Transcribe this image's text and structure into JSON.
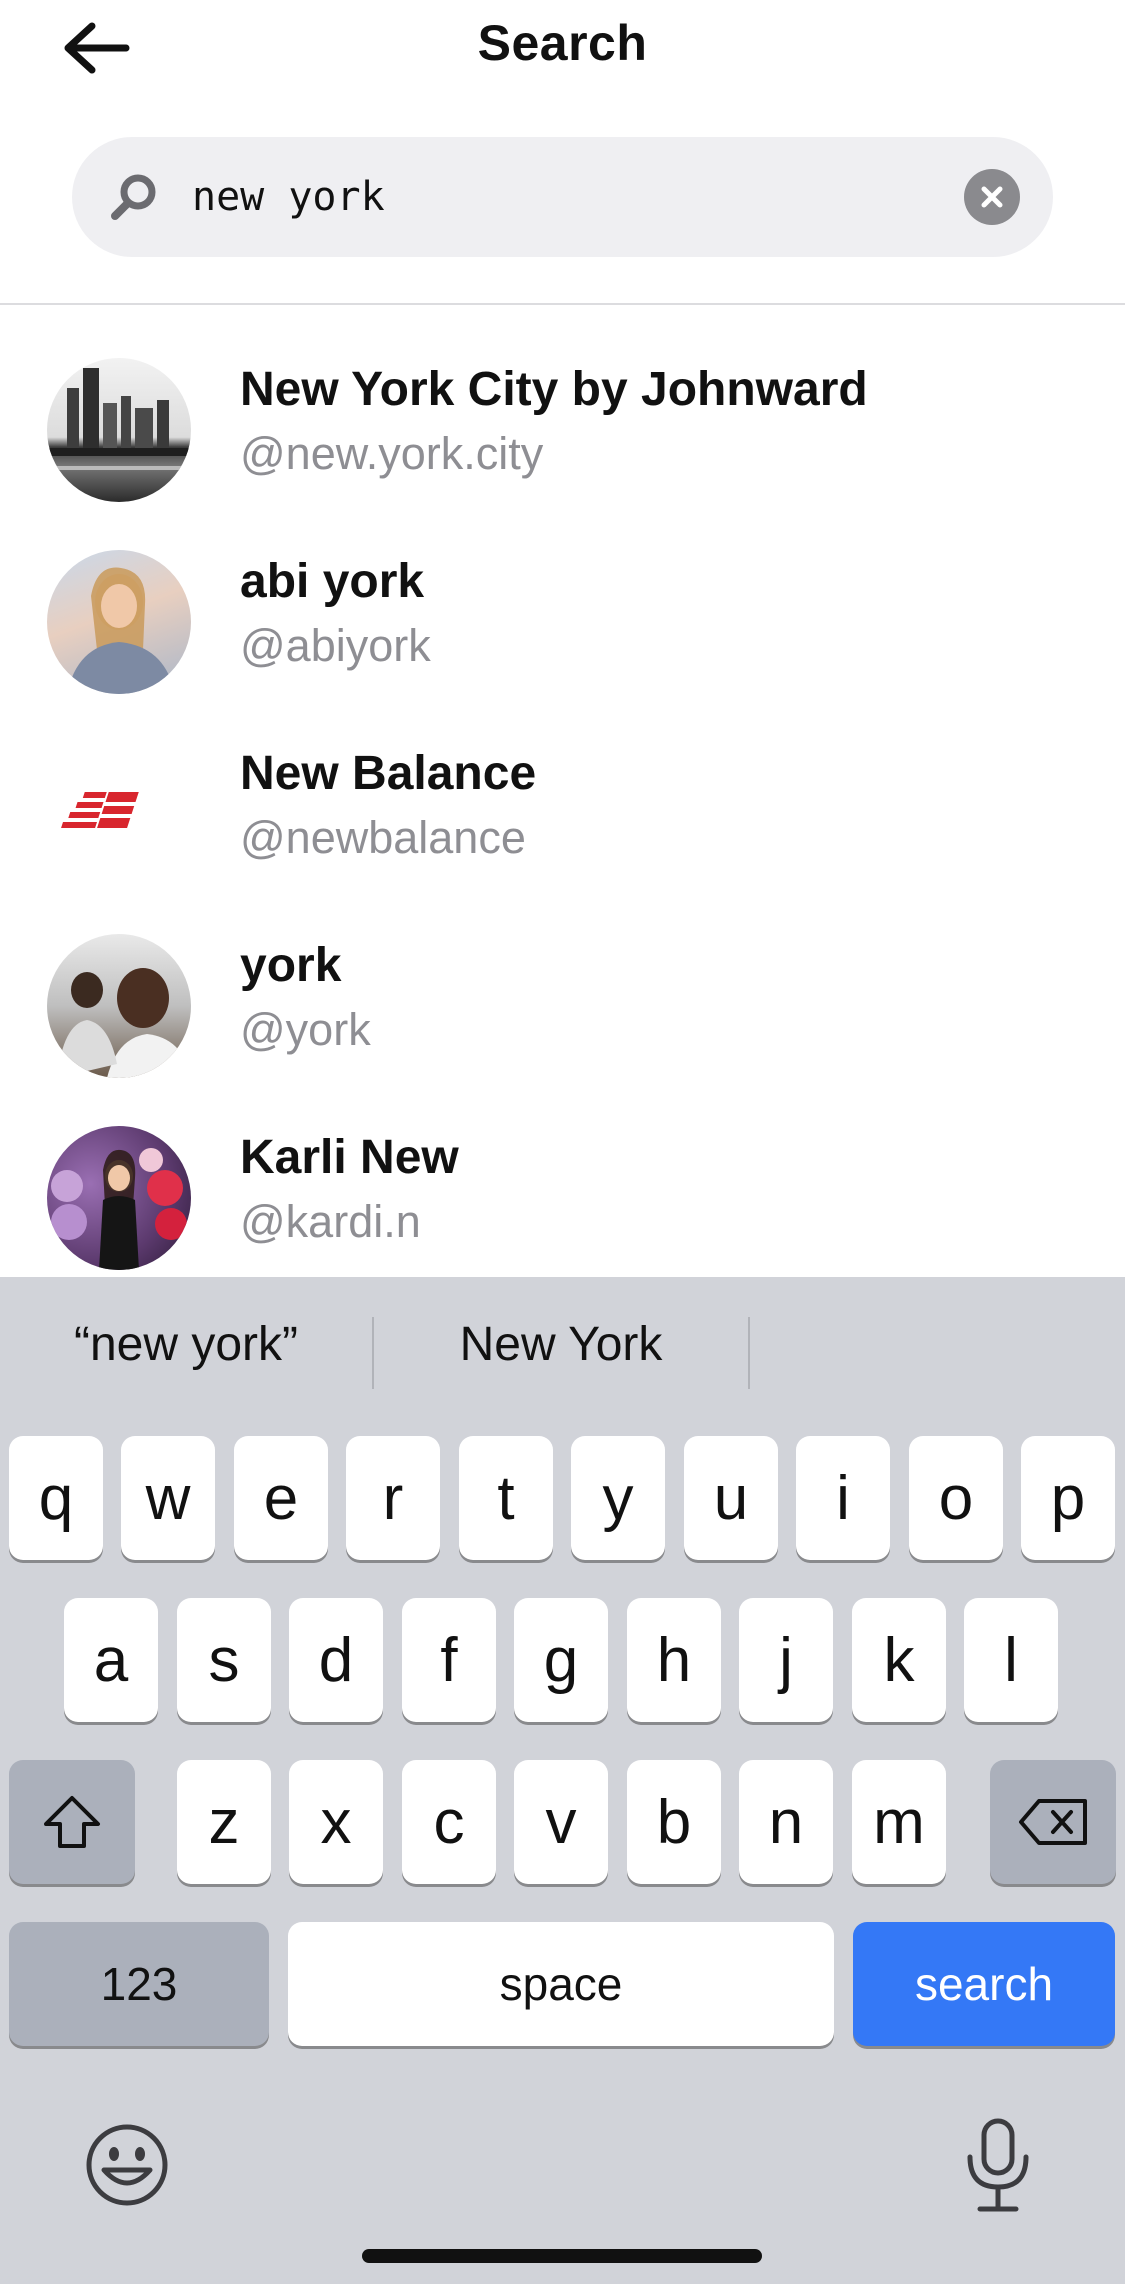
{
  "header": {
    "title": "Search"
  },
  "search": {
    "query": "new york"
  },
  "results": [
    {
      "name": "New York City by Johnward",
      "handle": "@new.york.city",
      "avatar": "city-skyline-photo"
    },
    {
      "name": "abi york",
      "handle": "@abiyork",
      "avatar": "person-photo"
    },
    {
      "name": "New Balance",
      "handle": "@newbalance",
      "avatar": "new-balance-logo"
    },
    {
      "name": "york",
      "handle": "@york",
      "avatar": "person-photo"
    },
    {
      "name": "Karli New",
      "handle": "@kardi.n",
      "avatar": "person-photo-balloons"
    }
  ],
  "keyboard": {
    "suggestions": [
      "“new york”",
      "New York",
      ""
    ],
    "row1": [
      "q",
      "w",
      "e",
      "r",
      "t",
      "y",
      "u",
      "i",
      "o",
      "p"
    ],
    "row2": [
      "a",
      "s",
      "d",
      "f",
      "g",
      "h",
      "j",
      "k",
      "l"
    ],
    "row3": [
      "z",
      "x",
      "c",
      "v",
      "b",
      "n",
      "m"
    ],
    "numbers_label": "123",
    "space_label": "space",
    "search_label": "search"
  },
  "colors": {
    "accent_blue": "#3478f6",
    "caret": "#34c759",
    "keyboard_bg": "#d1d3d9"
  }
}
